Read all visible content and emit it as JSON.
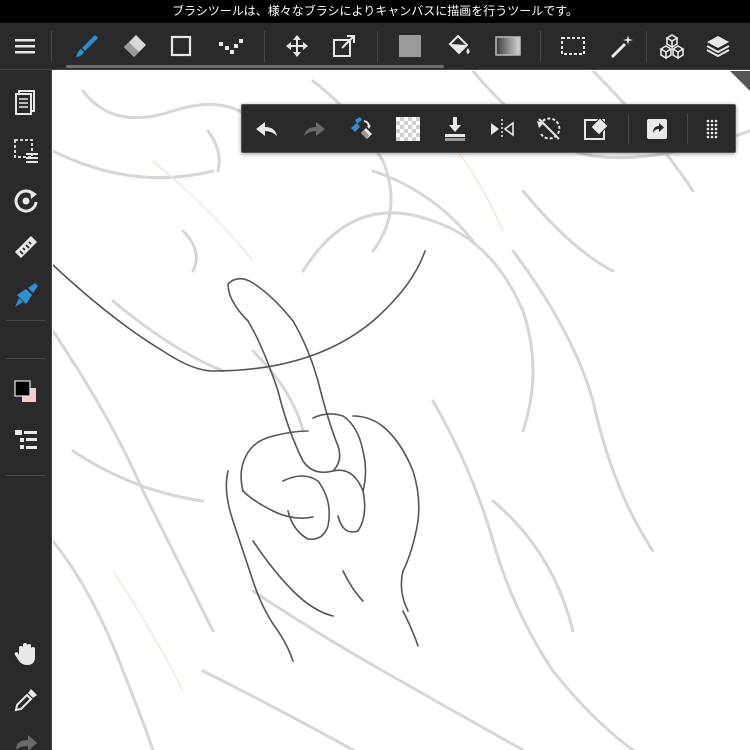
{
  "hint": {
    "text": "ブラシツールは、様々なブラシによりキャンバスに描画を行うツールです。"
  },
  "colors": {
    "toolbar_bg": "#2a2a2c",
    "icon": "#e8e8ea",
    "accent_blue": "#2f8fd0",
    "inactive": "#6a6a6c",
    "foreground_color": "#000000",
    "background_color": "#f4cccd"
  },
  "top_toolbar": {
    "items": [
      {
        "icon": "brush-icon",
        "active": true
      },
      {
        "icon": "eraser-icon"
      },
      {
        "icon": "shape-rectangle-icon"
      },
      {
        "icon": "dot-brush-icon"
      },
      {
        "icon": "move-icon"
      },
      {
        "icon": "transform-icon"
      },
      {
        "icon": "fill-color-icon"
      },
      {
        "icon": "bucket-icon"
      },
      {
        "icon": "gradient-icon"
      },
      {
        "icon": "select-rectangle-icon"
      },
      {
        "icon": "magic-wand-icon"
      },
      {
        "icon": "3d-material-icon"
      },
      {
        "icon": "layers-icon"
      }
    ]
  },
  "left_sidebar": {
    "items": [
      {
        "icon": "pages-icon"
      },
      {
        "icon": "selection-menu-icon"
      },
      {
        "icon": "rotate-icon"
      },
      {
        "icon": "ruler-icon"
      },
      {
        "icon": "brush-settings-icon",
        "active": true
      },
      {
        "icon": "color-swatch-icon"
      },
      {
        "icon": "layer-list-icon"
      },
      {
        "icon": "hand-icon"
      },
      {
        "icon": "eyedropper-icon"
      },
      {
        "icon": "redo-arrow-icon"
      }
    ]
  },
  "floating_toolbar": {
    "items": [
      {
        "icon": "undo-icon"
      },
      {
        "icon": "redo-icon",
        "disabled": true
      },
      {
        "icon": "brush-eraser-toggle-icon"
      },
      {
        "icon": "transparency-icon"
      },
      {
        "icon": "merge-down-icon"
      },
      {
        "icon": "flip-horizontal-icon"
      },
      {
        "icon": "rotate-reset-icon"
      },
      {
        "icon": "clear-layer-icon"
      },
      {
        "icon": "export-icon"
      },
      {
        "icon": "drag-handle-icon"
      }
    ]
  }
}
